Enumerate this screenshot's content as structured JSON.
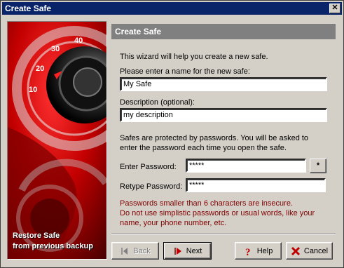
{
  "window": {
    "title": "Create Safe",
    "close_label": "✕"
  },
  "side_panel": {
    "restore_link": "Restore Safe\nfrom previous backup"
  },
  "header": {
    "title": "Create Safe"
  },
  "intro_text": "This wizard will help you create a new safe.",
  "name_field": {
    "label": "Please enter a name for the new safe:",
    "value": "My Safe"
  },
  "description_field": {
    "label": "Description (optional):",
    "value": "my description"
  },
  "password_info": {
    "line1": "Safes are protected by passwords. You will be asked to",
    "line2": "enter the password each time you open the safe."
  },
  "password_field": {
    "label": "Enter Password:",
    "value": "*****",
    "toggle_label": "*"
  },
  "retype_field": {
    "label": "Retype Password:",
    "value": "*****"
  },
  "warning": {
    "line1": "Passwords smaller than 6 characters are insecure.",
    "line2": "Do not use simplistic passwords or usual words, like your",
    "line3": "name, your phone number, etc."
  },
  "buttons": {
    "back": "Back",
    "next": "Next",
    "help": "Help",
    "cancel": "Cancel"
  },
  "colors": {
    "title_bar": "#0a246a",
    "header_band": "#808080",
    "warning_text": "#800000",
    "panel": "#c00000"
  },
  "icons": {
    "back": "back-arrow-icon",
    "next": "next-arrow-icon",
    "help": "help-icon",
    "cancel": "cancel-x-icon"
  }
}
